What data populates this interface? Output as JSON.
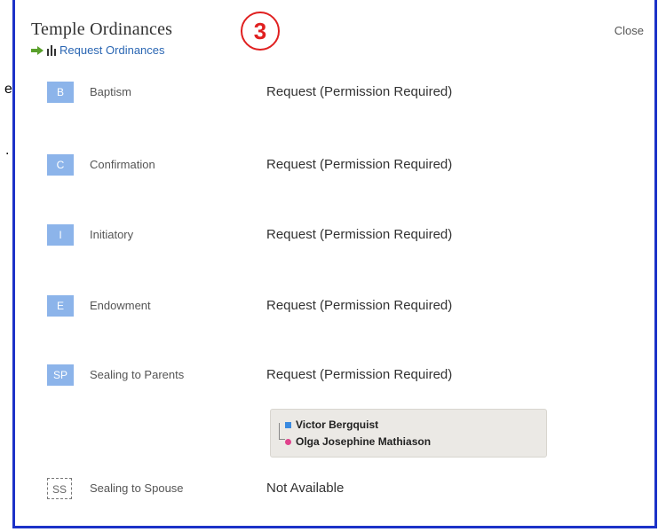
{
  "background_fragments": [
    "e",
    "."
  ],
  "dialog": {
    "title": "Temple Ordinances",
    "request_link": "Request Ordinances",
    "close_label": "Close",
    "step_number": "3"
  },
  "ordinances": [
    {
      "code": "B",
      "name": "Baptism",
      "status": "Request (Permission Required)"
    },
    {
      "code": "C",
      "name": "Confirmation",
      "status": "Request (Permission Required)"
    },
    {
      "code": "I",
      "name": "Initiatory",
      "status": "Request (Permission Required)"
    },
    {
      "code": "E",
      "name": "Endowment",
      "status": "Request (Permission Required)"
    },
    {
      "code": "SP",
      "name": "Sealing to Parents",
      "status": "Request (Permission Required)"
    },
    {
      "code": "SS",
      "name": "Sealing to Spouse",
      "status": "Not Available"
    }
  ],
  "parents": {
    "father": "Victor Bergquist",
    "mother": "Olga Josephine Mathiason"
  },
  "colors": {
    "ordinance_icon": "#8cb4ea",
    "link": "#2a66b3",
    "border": "#1c32c8",
    "badge": "#e02020",
    "father_marker": "#3a8ae0",
    "mother_marker": "#e0428c"
  }
}
